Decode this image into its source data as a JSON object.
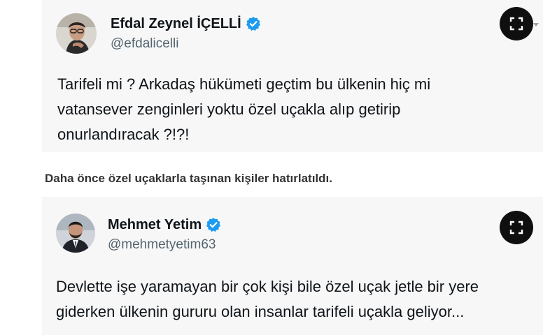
{
  "tweet1": {
    "name": "Efdal Zeynel İÇELLİ",
    "handle": "@efdalicelli",
    "text_lines": [
      "Tarifeli mi ? Arkadaş hükümeti geçtim bu ülkenin hiç mi",
      "vatansever zenginleri yoktu özel uçakla alıp getirip",
      "onurlandıracak ?!?!"
    ],
    "avatar_icon": "avatar-photo",
    "verified_icon": "verified-badge-icon",
    "expand_icon": "expand-icon"
  },
  "caption": "Daha önce özel uçaklarla taşınan kişiler hatırlatıldı.",
  "tweet2": {
    "name": "Mehmet Yetim",
    "handle": "@mehmetyetim63",
    "text_lines": [
      "Devlette işe yaramayan bir çok kişi bile özel uçak jetle bir yere",
      "giderken ülkenin gururu olan insanlar tarifeli uçakla geliyor..."
    ],
    "avatar_icon": "avatar-photo",
    "verified_icon": "verified-badge-icon",
    "expand_icon": "expand-icon"
  },
  "colors": {
    "verified_blue": "#1d9bf0",
    "expand_button": "#0f0f0f",
    "handle_gray": "#536471",
    "text": "#0f1419",
    "card_bg": "#f7f7f7"
  }
}
